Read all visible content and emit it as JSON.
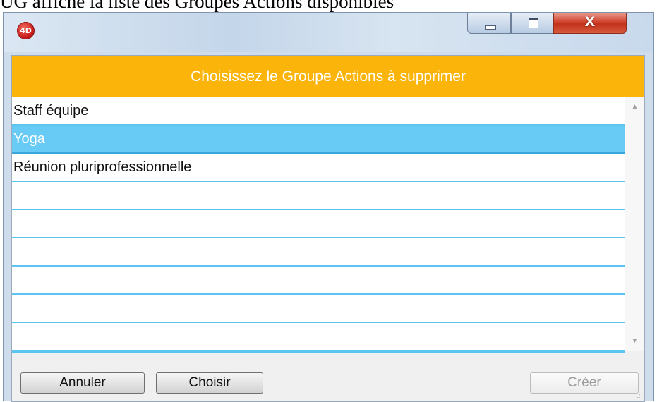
{
  "caption": "UG affiche la liste des Groupes Actions disponibles",
  "window": {
    "app_icon_text": "4D",
    "close_glyph": "X",
    "icons": {
      "app": "4d-app-icon",
      "minimize": "minimize-icon",
      "maximize": "maximize-icon",
      "close": "close-icon"
    }
  },
  "dialog": {
    "header": "Choisissez le Groupe Actions à supprimer",
    "header_color": "#fbb40a",
    "selection_color": "#67cbf5",
    "items": [
      {
        "label": "Staff équipe",
        "selected": false
      },
      {
        "label": "Yoga",
        "selected": true
      },
      {
        "label": "Réunion pluriprofessionnelle",
        "selected": false
      },
      {
        "label": "",
        "selected": false
      },
      {
        "label": "",
        "selected": false
      },
      {
        "label": "",
        "selected": false
      },
      {
        "label": "",
        "selected": false
      },
      {
        "label": "",
        "selected": false
      },
      {
        "label": "",
        "selected": false
      }
    ],
    "scroll_up": "▲",
    "scroll_down": "▼",
    "buttons": {
      "cancel": "Annuler",
      "choose": "Choisir",
      "create": "Créer"
    }
  }
}
